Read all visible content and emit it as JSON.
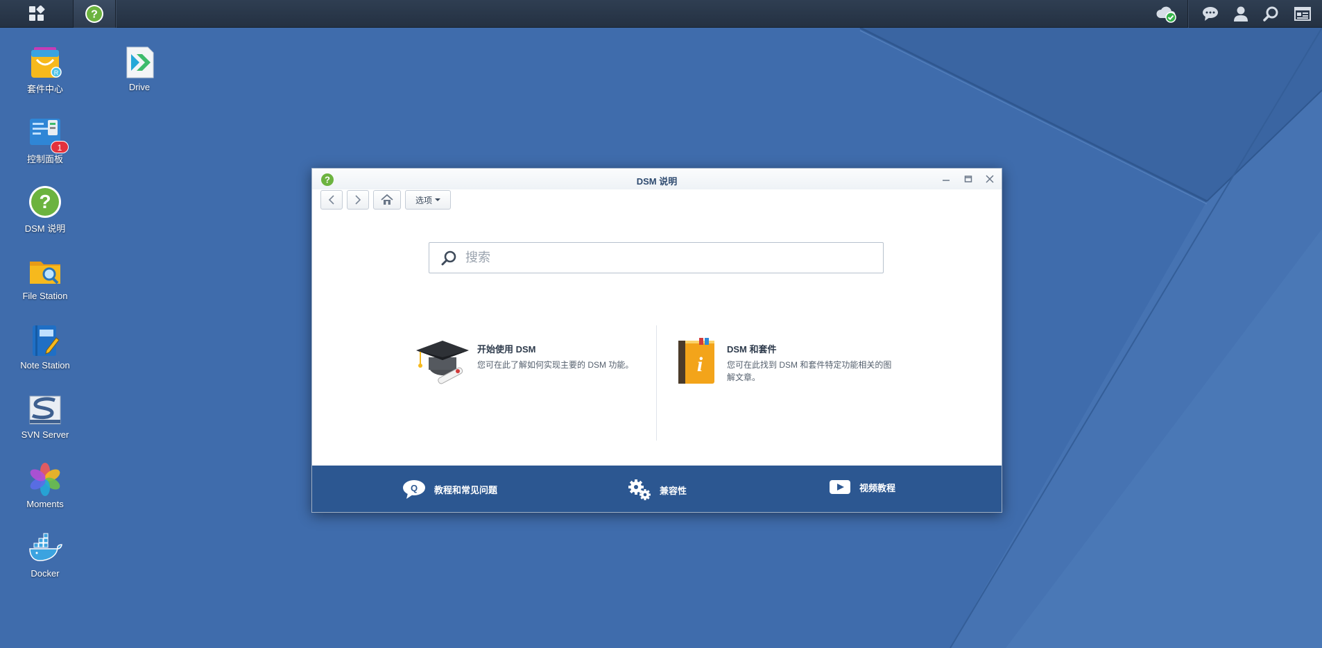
{
  "taskbar": {
    "main_menu_icon": "grid-icon",
    "pinned_app_icon": "help-icon",
    "right_icons": [
      "cloud-sync-icon",
      "chat-icon",
      "user-icon",
      "search-icon",
      "widgets-icon"
    ]
  },
  "desktop": {
    "icons": [
      {
        "label": "套件中心",
        "icon": "package-center-icon"
      },
      {
        "label": "Drive",
        "icon": "drive-icon"
      },
      {
        "label": "控制面板",
        "icon": "control-panel-icon",
        "badge": "1"
      },
      {
        "label": "DSM 说明",
        "icon": "help-icon"
      },
      {
        "label": "File Station",
        "icon": "folder-search-icon"
      },
      {
        "label": "Note Station",
        "icon": "notebook-icon"
      },
      {
        "label": "SVN Server",
        "icon": "svn-icon"
      },
      {
        "label": "Moments",
        "icon": "moments-flower-icon"
      },
      {
        "label": "Docker",
        "icon": "docker-whale-icon"
      }
    ]
  },
  "window": {
    "title": "DSM 说明",
    "toolbar": {
      "options_label": "选项"
    },
    "search": {
      "placeholder": "搜索"
    },
    "cards": [
      {
        "title": "开始使用 DSM",
        "desc": "您可在此了解如何实现主要的 DSM 功能。",
        "icon": "graduation-cap-icon"
      },
      {
        "title": "DSM 和套件",
        "desc_line1": "您可在此找到 DSM 和套件特定功能相关的图",
        "desc_line2": "解文章。",
        "icon": "info-book-icon"
      }
    ],
    "footer": [
      {
        "label": "教程和常见问题",
        "icon": "faq-bubble-icon"
      },
      {
        "label": "兼容性",
        "icon": "gears-icon"
      },
      {
        "label": "视频教程",
        "icon": "play-video-icon"
      }
    ]
  },
  "colors": {
    "desktop_bg": "#3f6cac",
    "taskbar_bg": "#243142",
    "footer_bg": "#2c5791",
    "help_green": "#6cb33f"
  }
}
